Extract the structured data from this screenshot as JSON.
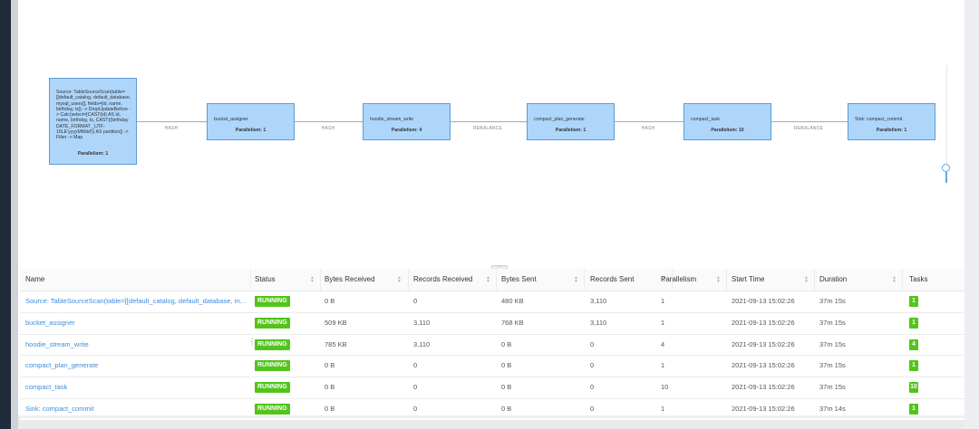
{
  "graph": {
    "nodes": [
      {
        "id": "source",
        "title": "Source: TableSourceScan(table=[[default_catalog, default_database, mysql_users]], fields=[id, name, birthday, ts]) -> DropUpdateBefore -> Calc(select=[CAST(id) AS id, name, birthday, ts, CAST((birthday DATE_FORMAT _UTF-16LE'yyyyMMdd')) AS partition]) -> Filter -> Map",
        "parallelism": "Parallelism: 1"
      },
      {
        "id": "bucket_assigner",
        "title": "bucket_assigner",
        "parallelism": "Parallelism: 1"
      },
      {
        "id": "hoodie_stream_write",
        "title": "hoodie_stream_write",
        "parallelism": "Parallelism: 4"
      },
      {
        "id": "compact_plan_generate",
        "title": "compact_plan_generate",
        "parallelism": "Parallelism: 1"
      },
      {
        "id": "compact_task",
        "title": "compact_task",
        "parallelism": "Parallelism: 10"
      },
      {
        "id": "sink",
        "title": "Sink: compact_commit",
        "parallelism": "Parallelism: 1"
      }
    ],
    "edges": [
      {
        "label": "HASH"
      },
      {
        "label": "HASH"
      },
      {
        "label": "REBALANCE"
      },
      {
        "label": "HASH"
      },
      {
        "label": "REBALANCE"
      }
    ]
  },
  "table": {
    "columns": {
      "name": "Name",
      "status": "Status",
      "bytes_received": "Bytes Received",
      "records_received": "Records Received",
      "bytes_sent": "Bytes Sent",
      "records_sent": "Records Sent",
      "parallelism": "Parallelism",
      "start_time": "Start Time",
      "duration": "Duration",
      "tasks": "Tasks"
    },
    "rows": [
      {
        "name": "Source: TableSourceScan(table=[[default_catalog, default_database, m...",
        "status": "RUNNING",
        "bytes_received": "0 B",
        "records_received": "0",
        "bytes_sent": "480 KB",
        "records_sent": "3,110",
        "parallelism": "1",
        "start_time": "2021-09-13 15:02:26",
        "duration": "37m 15s",
        "tasks": "1"
      },
      {
        "name": "bucket_assigner",
        "status": "RUNNING",
        "bytes_received": "509 KB",
        "records_received": "3,110",
        "bytes_sent": "768 KB",
        "records_sent": "3,110",
        "parallelism": "1",
        "start_time": "2021-09-13 15:02:26",
        "duration": "37m 15s",
        "tasks": "1"
      },
      {
        "name": "hoodie_stream_write",
        "status": "RUNNING",
        "bytes_received": "785 KB",
        "records_received": "3,110",
        "bytes_sent": "0 B",
        "records_sent": "0",
        "parallelism": "4",
        "start_time": "2021-09-13 15:02:26",
        "duration": "37m 15s",
        "tasks": "4"
      },
      {
        "name": "compact_plan_generate",
        "status": "RUNNING",
        "bytes_received": "0 B",
        "records_received": "0",
        "bytes_sent": "0 B",
        "records_sent": "0",
        "parallelism": "1",
        "start_time": "2021-09-13 15:02:26",
        "duration": "37m 15s",
        "tasks": "1"
      },
      {
        "name": "compact_task",
        "status": "RUNNING",
        "bytes_received": "0 B",
        "records_received": "0",
        "bytes_sent": "0 B",
        "records_sent": "0",
        "parallelism": "10",
        "start_time": "2021-09-13 15:02:26",
        "duration": "37m 15s",
        "tasks": "10"
      },
      {
        "name": "Sink: compact_commit",
        "status": "RUNNING",
        "bytes_received": "0 B",
        "records_received": "0",
        "bytes_sent": "0 B",
        "records_sent": "0",
        "parallelism": "1",
        "start_time": "2021-09-13 15:02:26",
        "duration": "37m 14s",
        "tasks": "1"
      }
    ]
  },
  "colors": {
    "node_fill": "#aed6fb",
    "node_border": "#5b9bd6",
    "running": "#52c41a",
    "link": "#3c8ddc"
  }
}
